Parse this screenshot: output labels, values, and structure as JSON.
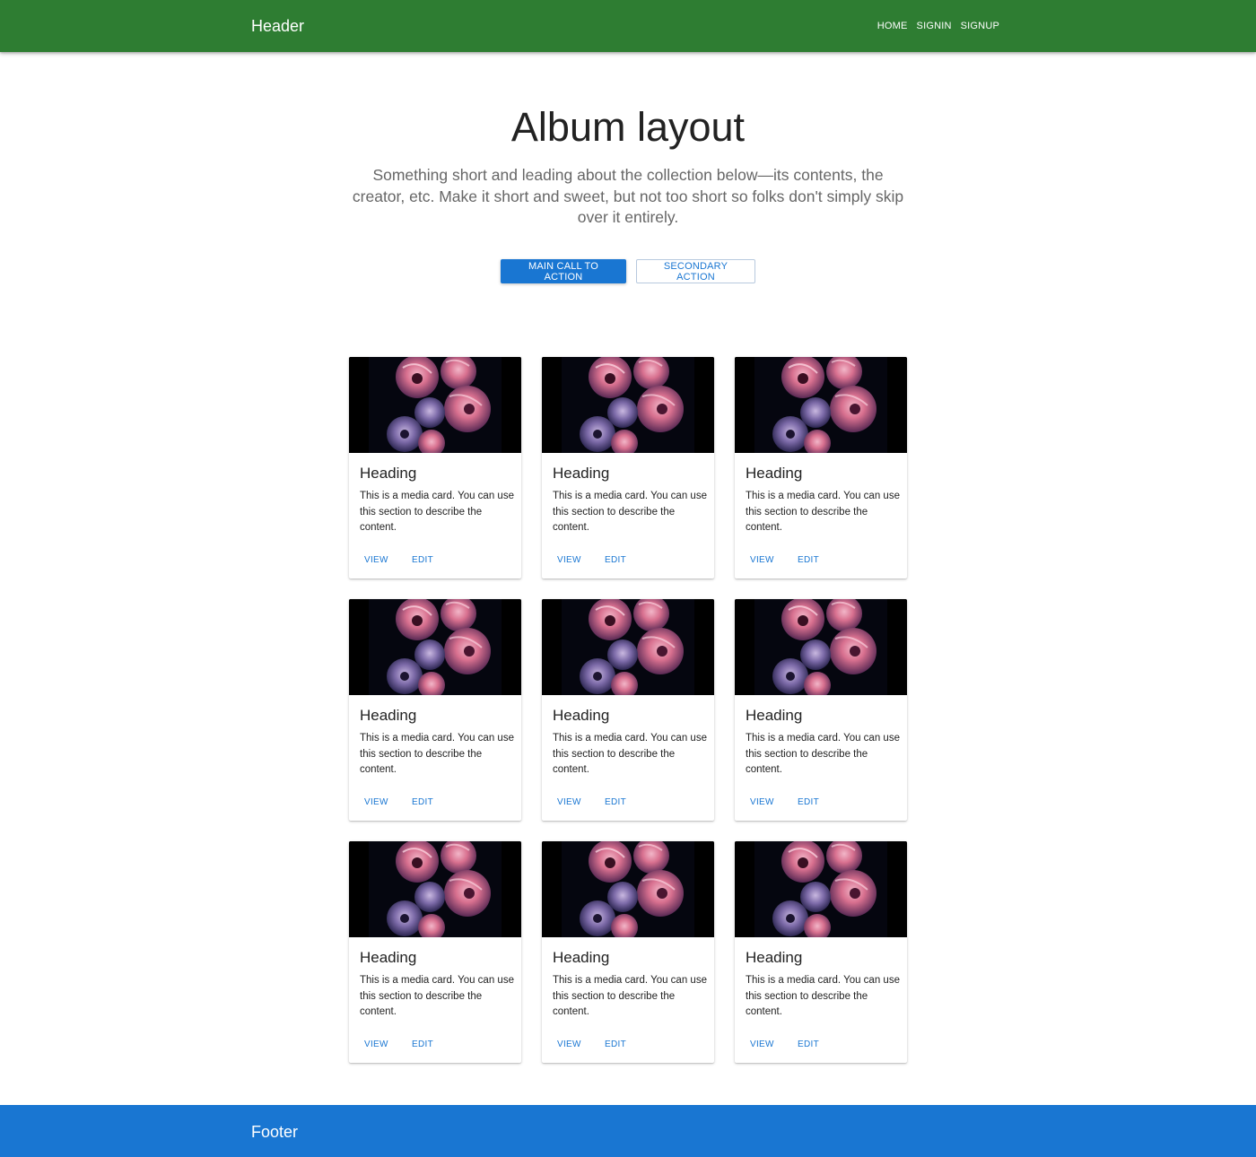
{
  "header": {
    "title": "Header",
    "nav": [
      {
        "label": "HOME"
      },
      {
        "label": "SIGNIN"
      },
      {
        "label": "SIGNUP"
      }
    ]
  },
  "hero": {
    "title": "Album layout",
    "description": "Something short and leading about the collection below—its contents, the creator, etc. Make it short and sweet, but not too short so folks don't simply skip over it entirely.",
    "primary_action": "MAIN CALL TO ACTION",
    "secondary_action": "SECONDARY ACTION"
  },
  "cards": [
    {
      "heading": "Heading",
      "text": "This is a media card. You can use this section to describe the content.",
      "view": "VIEW",
      "edit": "EDIT"
    },
    {
      "heading": "Heading",
      "text": "This is a media card. You can use this section to describe the content.",
      "view": "VIEW",
      "edit": "EDIT"
    },
    {
      "heading": "Heading",
      "text": "This is a media card. You can use this section to describe the content.",
      "view": "VIEW",
      "edit": "EDIT"
    },
    {
      "heading": "Heading",
      "text": "This is a media card. You can use this section to describe the content.",
      "view": "VIEW",
      "edit": "EDIT"
    },
    {
      "heading": "Heading",
      "text": "This is a media card. You can use this section to describe the content.",
      "view": "VIEW",
      "edit": "EDIT"
    },
    {
      "heading": "Heading",
      "text": "This is a media card. You can use this section to describe the content.",
      "view": "VIEW",
      "edit": "EDIT"
    },
    {
      "heading": "Heading",
      "text": "This is a media card. You can use this section to describe the content.",
      "view": "VIEW",
      "edit": "EDIT"
    },
    {
      "heading": "Heading",
      "text": "This is a media card. You can use this section to describe the content.",
      "view": "VIEW",
      "edit": "EDIT"
    },
    {
      "heading": "Heading",
      "text": "This is a media card. You can use this section to describe the content.",
      "view": "VIEW",
      "edit": "EDIT"
    }
  ],
  "footer": {
    "text": "Footer"
  },
  "colors": {
    "header_bg": "#2e7d32",
    "footer_bg": "#1976d2",
    "primary": "#1976d2"
  }
}
